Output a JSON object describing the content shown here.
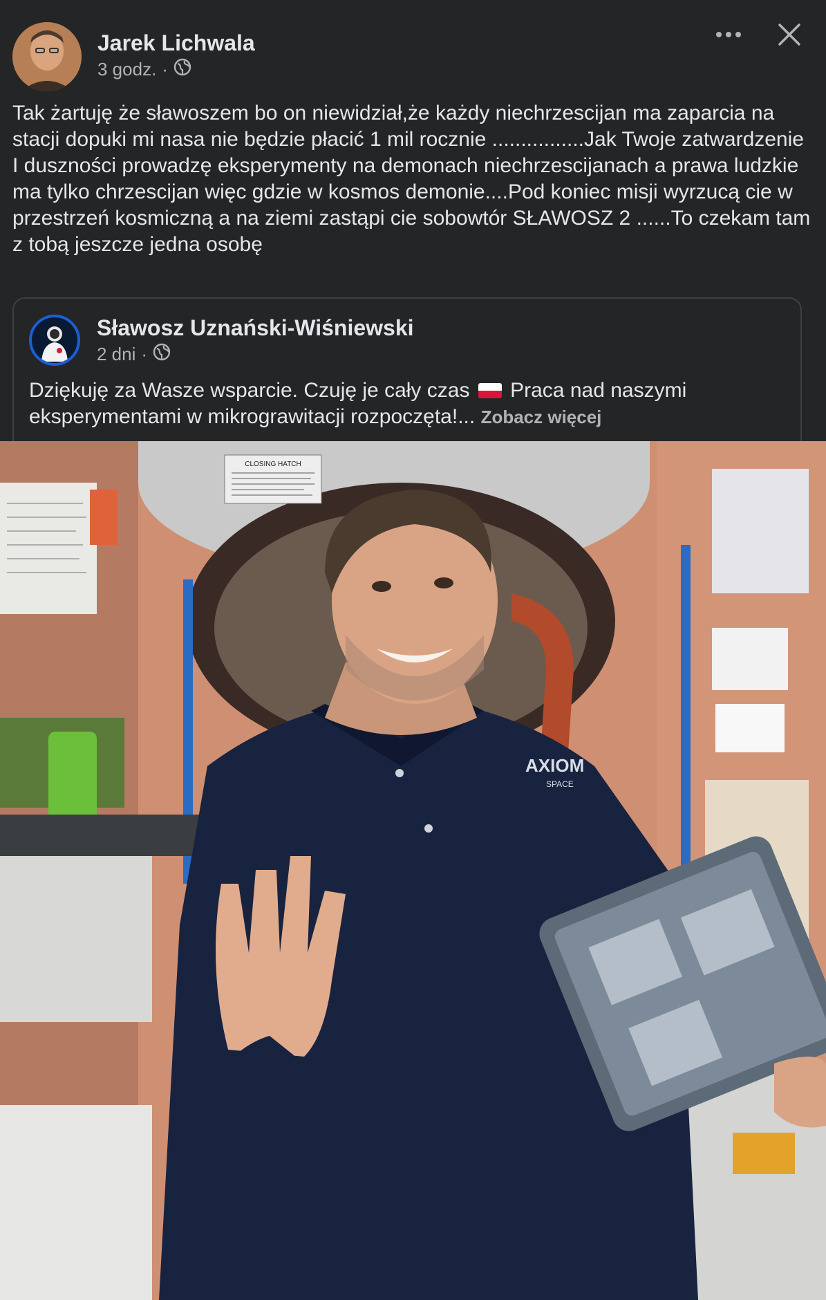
{
  "post": {
    "author": "Jarek Lichwala",
    "time": "3 godz.",
    "separator": "·",
    "privacy_icon": "globe-icon",
    "text": "Tak żartuję że sławoszem bo on niewidział,że każdy niechrzescijan ma zaparcia na stacji dopuki mi nasa nie będzie płacić 1 mil rocznie ................Jak Twoje zatwardzenie I duszności prowadzę eksperymenty na demonach niechrzescijanach a prawa ludzkie ma tylko chrzescijan więc gdzie w kosmos demonie....Pod koniec misji wyrzucą cie w przestrzeń kosmiczną a na ziemi zastąpi cie sobowtór SŁAWOSZ 2 ......To czekam tam z tobą jeszcze jedna osobę"
  },
  "header": {
    "more_icon": "more-options-icon",
    "close_icon": "close-icon"
  },
  "shared": {
    "author": "Sławosz Uznański-Wiśniewski",
    "time": "2 dni",
    "separator": "·",
    "text_before_flag": "Dziękuję za Wasze wsparcie. Czuję je cały czas ",
    "text_after_flag": " Praca nad naszymi eksperymentami w mikrograwitacji rozpoczęta!...",
    "see_more": "Zobacz więcej",
    "photo_brand": "AXIOM",
    "photo_brand_sub": "SPACE",
    "hatch_label": "CLOSING HATCH"
  },
  "colors": {
    "background": "#242526",
    "text_primary": "#e4e6eb",
    "text_secondary": "#b0b3b8",
    "card_border": "#3e4042",
    "avatar_ring": "#1a5fd6"
  }
}
